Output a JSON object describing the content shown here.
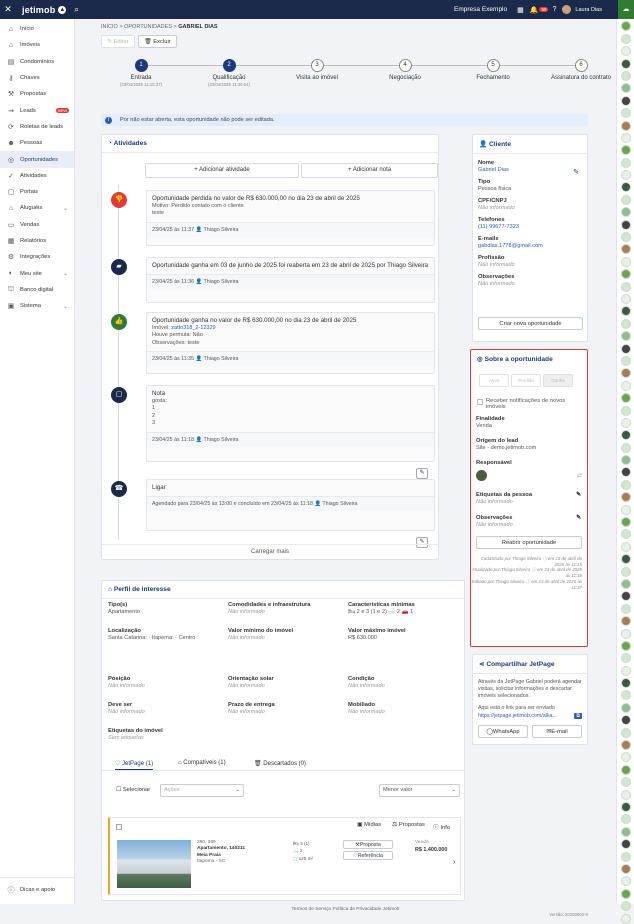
{
  "topbar": {
    "logo": "jetimob",
    "company": "Empresa Exemplo",
    "notif_count": "99",
    "user": "Laura Dias"
  },
  "sidebar": {
    "items": [
      {
        "label": "Início",
        "icon": "home-icon"
      },
      {
        "label": "Imóveis",
        "icon": "house-icon"
      },
      {
        "label": "Condomínios",
        "icon": "building-icon"
      },
      {
        "label": "Chaves",
        "icon": "key-icon"
      },
      {
        "label": "Propostas",
        "icon": "gavel-icon"
      },
      {
        "label": "Leads",
        "icon": "leads-icon",
        "badge": "NEW"
      },
      {
        "label": "Roletas de leads",
        "icon": "roulette-icon"
      },
      {
        "label": "Pessoas",
        "icon": "people-icon"
      },
      {
        "label": "Oportunidades",
        "icon": "target-icon",
        "active": true
      },
      {
        "label": "Atividades",
        "icon": "check-icon"
      },
      {
        "label": "Portais",
        "icon": "portal-icon"
      },
      {
        "label": "Aluguéis",
        "icon": "rent-icon",
        "chevron": true
      },
      {
        "label": "Vendas",
        "icon": "sales-icon"
      },
      {
        "label": "Relatórios",
        "icon": "report-icon"
      },
      {
        "label": "Integrações",
        "icon": "integration-icon"
      },
      {
        "label": "Meu site",
        "icon": "site-icon",
        "chevron": true
      },
      {
        "label": "Banco digital",
        "icon": "bank-icon"
      },
      {
        "label": "Sistema",
        "icon": "system-icon",
        "chevron": true
      }
    ],
    "help": "Dicas e apoio"
  },
  "breadcrumb": {
    "a": "INÍCIO",
    "b": "OPORTUNIDADES",
    "c": "GABRIEL DIAS"
  },
  "toolbar": {
    "edit": "Editar",
    "delete": "Excluir"
  },
  "steps": [
    {
      "n": "1",
      "label": "Entrada",
      "sub": "(23/04/2025 11:15:37)",
      "done": true
    },
    {
      "n": "2",
      "label": "Qualificação",
      "sub": "(23/04/2025 11:36:54)",
      "done": true
    },
    {
      "n": "3",
      "label": "Visita ao imóvel",
      "sub": "",
      "done": false
    },
    {
      "n": "4",
      "label": "Negociação",
      "sub": "",
      "done": false
    },
    {
      "n": "5",
      "label": "Fechamento",
      "sub": "",
      "done": false
    },
    {
      "n": "6",
      "label": "Assinatura do contrato",
      "sub": "",
      "done": false
    }
  ],
  "info": "Por não estar aberta, esta oportunidade não pode ser editada.",
  "activities": {
    "title": "Atividades",
    "add_activity": "+ Adicionar atividade",
    "add_note": "+ Adicionar nota",
    "items": [
      {
        "title": "Oportunidade perdida no valor de R$ 630.000,00 no dia 23 de abril de 2025",
        "lines": [
          "Motivo: Perdido contato com o cliente",
          "teste"
        ],
        "footer": "23/04/25 às 11:37  👤 Thiago Silveira"
      },
      {
        "title": "Oportunidade ganha em 03 de junho de 2025 foi reaberta em 23 de abril de 2025 por Thiago Silveira",
        "lines": [],
        "footer": "23/04/25 às 11:36  👤 Thiago Silveira"
      },
      {
        "title": "Oportunidade ganha no valor de R$ 630.000,00 no dia 23 de abril de 2025",
        "lines": [
          "Imóvel: zatto318_2-12329",
          "Houve permuta: Não",
          "Observações: teste"
        ],
        "footer": "23/04/25 às 11:35  👤 Thiago Silveira"
      },
      {
        "title": "Nota",
        "lines": [
          "gosta:",
          "1",
          "2",
          "3"
        ],
        "footer": "23/04/25 às 11:18  👤 Thiago Silveira"
      },
      {
        "title": "Ligar",
        "lines": [],
        "footer": "Agendado para 23/04/25 às 13:00 e concluído em 23/04/25 às 11:18  👤 Thiago Silveira"
      }
    ],
    "load_more": "Carregar mais"
  },
  "client": {
    "title": "Cliente",
    "fields": [
      {
        "label": "Nome",
        "value": "Gabriel Dias",
        "style": "blue"
      },
      {
        "label": "Tipo",
        "value": "Pessoa física",
        "style": ""
      },
      {
        "label": "CPF/CNPJ",
        "value": "Não informado",
        "style": "it"
      },
      {
        "label": "Telefones",
        "value": "(11) 99677-7323",
        "style": "blue"
      },
      {
        "label": "E-mails",
        "value": "gabdias.1778@gmail.com",
        "style": "blue"
      },
      {
        "label": "Profissão",
        "value": "Não informado",
        "style": "it"
      },
      {
        "label": "Observações",
        "value": "Não informado",
        "style": "it"
      }
    ],
    "new_opp": "Criar nova oportunidade"
  },
  "about": {
    "title": "Sobre a oportunidade",
    "status_btns": [
      "Ativa",
      "Perdida",
      "Ganha"
    ],
    "notify": "Receber notificações de novos imóveis",
    "finalidade_l": "Finalidade",
    "finalidade_v": "Venda",
    "origem_l": "Origem do lead",
    "origem_v": "Site - demo.jetimob.com",
    "resp_l": "Responsável",
    "etiq_l": "Etiquetas da pessoa",
    "etiq_v": "Não informado",
    "obs_l": "Observações",
    "obs_v": "Não informado",
    "reopen": "Reabrir oportunidade",
    "log1": "Cadastrado por Thiago Silveira ⓘ em 23 de abril de 2025 às 11:15",
    "log2": "Atualizado por Thiago Silveira ⓘ em 23 de abril de 2025 às 11:18",
    "log3": "Editado por Thiago Silveira ⓘ em 23 de abril de 2025 às 11:37"
  },
  "share": {
    "title": "Compartilhar JetPage",
    "text": "Através da JetPage Gabriel poderá agendar visitas, solicitar informações e descartar imóveis selecionados.",
    "link_label": "Aqui está o link para ser enviado",
    "link": "https://jetpage.jetimob.com/alka...",
    "whatsapp": "WhatsApp",
    "email": "E-mail"
  },
  "profile": {
    "title": "Perfil de interesse",
    "cols": [
      [
        {
          "l": "Tipo(s)",
          "v": "Apartamento",
          "it": false
        },
        {
          "l": "Localização",
          "v": "Santa Catarina: · Itapema: · Centro",
          "it": false
        },
        {
          "l": "Posição",
          "v": "Não informado",
          "it": true
        },
        {
          "l": "Deve ser",
          "v": "Não informado",
          "it": true
        },
        {
          "l": "Etiquetas do imóvel",
          "v": "Sem etiquetas",
          "it": true
        }
      ],
      [
        {
          "l": "Comodidades e infraestrutura",
          "v": "Não informado",
          "it": true
        },
        {
          "l": "Valor mínimo do imóvel",
          "v": "Não informado",
          "it": true
        },
        {
          "l": "Orientação solar",
          "v": "Não informado",
          "it": true
        },
        {
          "l": "Prazo de entrega",
          "v": "Não informado",
          "it": true
        }
      ],
      [
        {
          "l": "Características mínimas",
          "v": "🛏 2 e 3 (1 e 2)  🛁 2  🚗 1",
          "it": false
        },
        {
          "l": "Valor máximo imóvel",
          "v": "R$ 630.000",
          "it": false
        },
        {
          "l": "Condição",
          "v": "Não informado",
          "it": true
        },
        {
          "l": "Mobiliado",
          "v": "Não informado",
          "it": true
        }
      ]
    ],
    "tabs": [
      "JetPage (1)",
      "Compatíveis (1)",
      "Descartados (0)"
    ],
    "select_all": "Selecionar",
    "actions": "Ações",
    "sort": "Menor valor",
    "prop": {
      "media": "Mídias",
      "proposals": "Propostas",
      "info": "Info",
      "ref": "280, 389",
      "type": "Apartamento, 140211",
      "name": "Meia Praia",
      "city": "Itapema - SC",
      "specs": [
        "3 (1)",
        "2",
        "120 m²"
      ],
      "proposta": "Proposta",
      "referencia": "Referência",
      "sale": "Venda",
      "price": "R$ 1.400.000"
    }
  },
  "footer": {
    "links": "Termos de Serviço    Política de Privacidade    Jetimob",
    "version": "Versão: 20250602-0"
  }
}
